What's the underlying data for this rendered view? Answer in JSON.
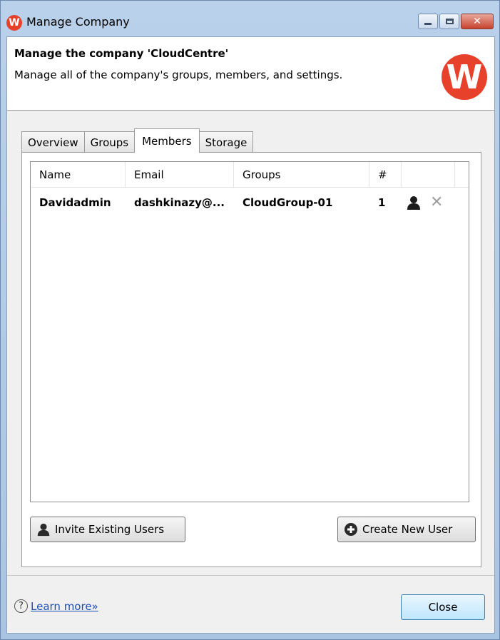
{
  "window": {
    "title": "Manage Company",
    "app_icon_letter": "W",
    "controls": {
      "minimize": "minimize",
      "maximize": "maximize",
      "close": "close"
    }
  },
  "header": {
    "title": "Manage the company 'CloudCentre'",
    "description": "Manage all of the company's groups, members, and settings.",
    "logo_letter": "W",
    "logo_color": "#e8412b"
  },
  "tabs": [
    {
      "label": "Overview",
      "active": false
    },
    {
      "label": "Groups",
      "active": false
    },
    {
      "label": "Members",
      "active": true
    },
    {
      "label": "Storage",
      "active": false
    }
  ],
  "members_table": {
    "columns": [
      "Name",
      "Email",
      "Groups",
      "#"
    ],
    "rows": [
      {
        "name": "Davidadmin",
        "email": "dashkinazy@...",
        "groups": "CloudGroup-01",
        "count": "1",
        "icons": [
          "user-icon",
          "remove-icon"
        ]
      }
    ]
  },
  "buttons": {
    "invite": "Invite Existing Users",
    "create": "Create New User",
    "close": "Close"
  },
  "footer": {
    "help_icon": "?",
    "learn_more": "Learn more»"
  }
}
